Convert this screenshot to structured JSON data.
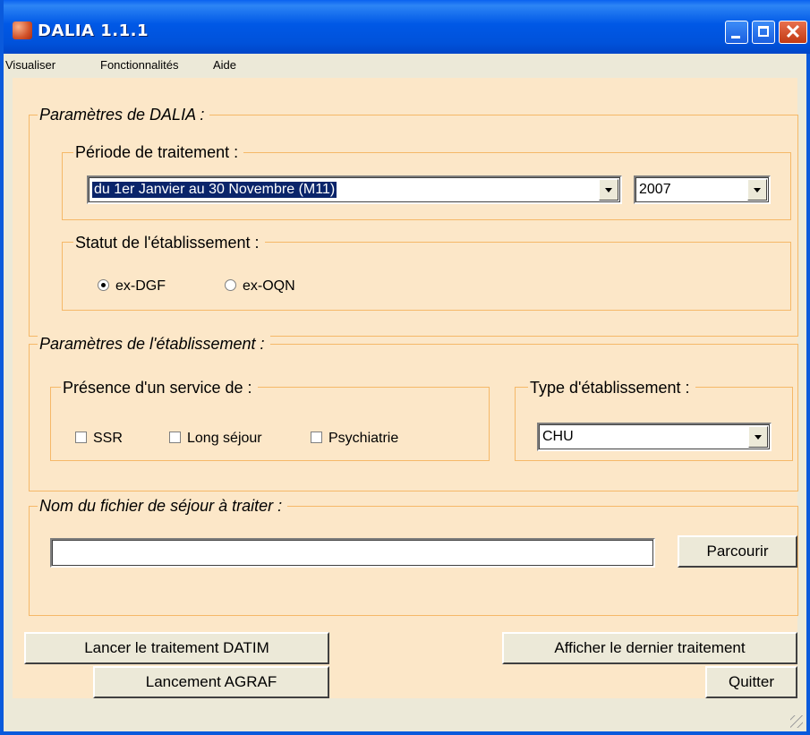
{
  "window": {
    "title": "DALIA 1.1.1"
  },
  "menu": {
    "items": [
      "Visualiser",
      "Fonctionnalités",
      "Aide"
    ]
  },
  "dalia_params": {
    "legend": "Paramètres de DALIA :",
    "period": {
      "legend": "Période de traitement :",
      "selected": "du 1er Janvier au 30 Novembre (M11)",
      "year": "2007"
    },
    "status": {
      "legend": "Statut de l'établissement :",
      "options": [
        {
          "label": "ex-DGF",
          "checked": true
        },
        {
          "label": "ex-OQN",
          "checked": false
        }
      ]
    }
  },
  "establishment_params": {
    "legend": "Paramètres de l'établissement :",
    "services": {
      "legend": "Présence d'un service de :",
      "options": [
        {
          "label": "SSR",
          "checked": false
        },
        {
          "label": "Long séjour",
          "checked": false
        },
        {
          "label": "Psychiatrie",
          "checked": false
        }
      ]
    },
    "type": {
      "legend": "Type d'établissement :",
      "selected": "CHU"
    }
  },
  "file": {
    "legend": "Nom du fichier de séjour à traiter :",
    "value": "",
    "browse_label": "Parcourir"
  },
  "actions": {
    "launch_datim": "Lancer le traitement DATIM",
    "launch_agraf": "Lancement AGRAF",
    "show_last": "Afficher le dernier traitement",
    "quit": "Quitter"
  }
}
